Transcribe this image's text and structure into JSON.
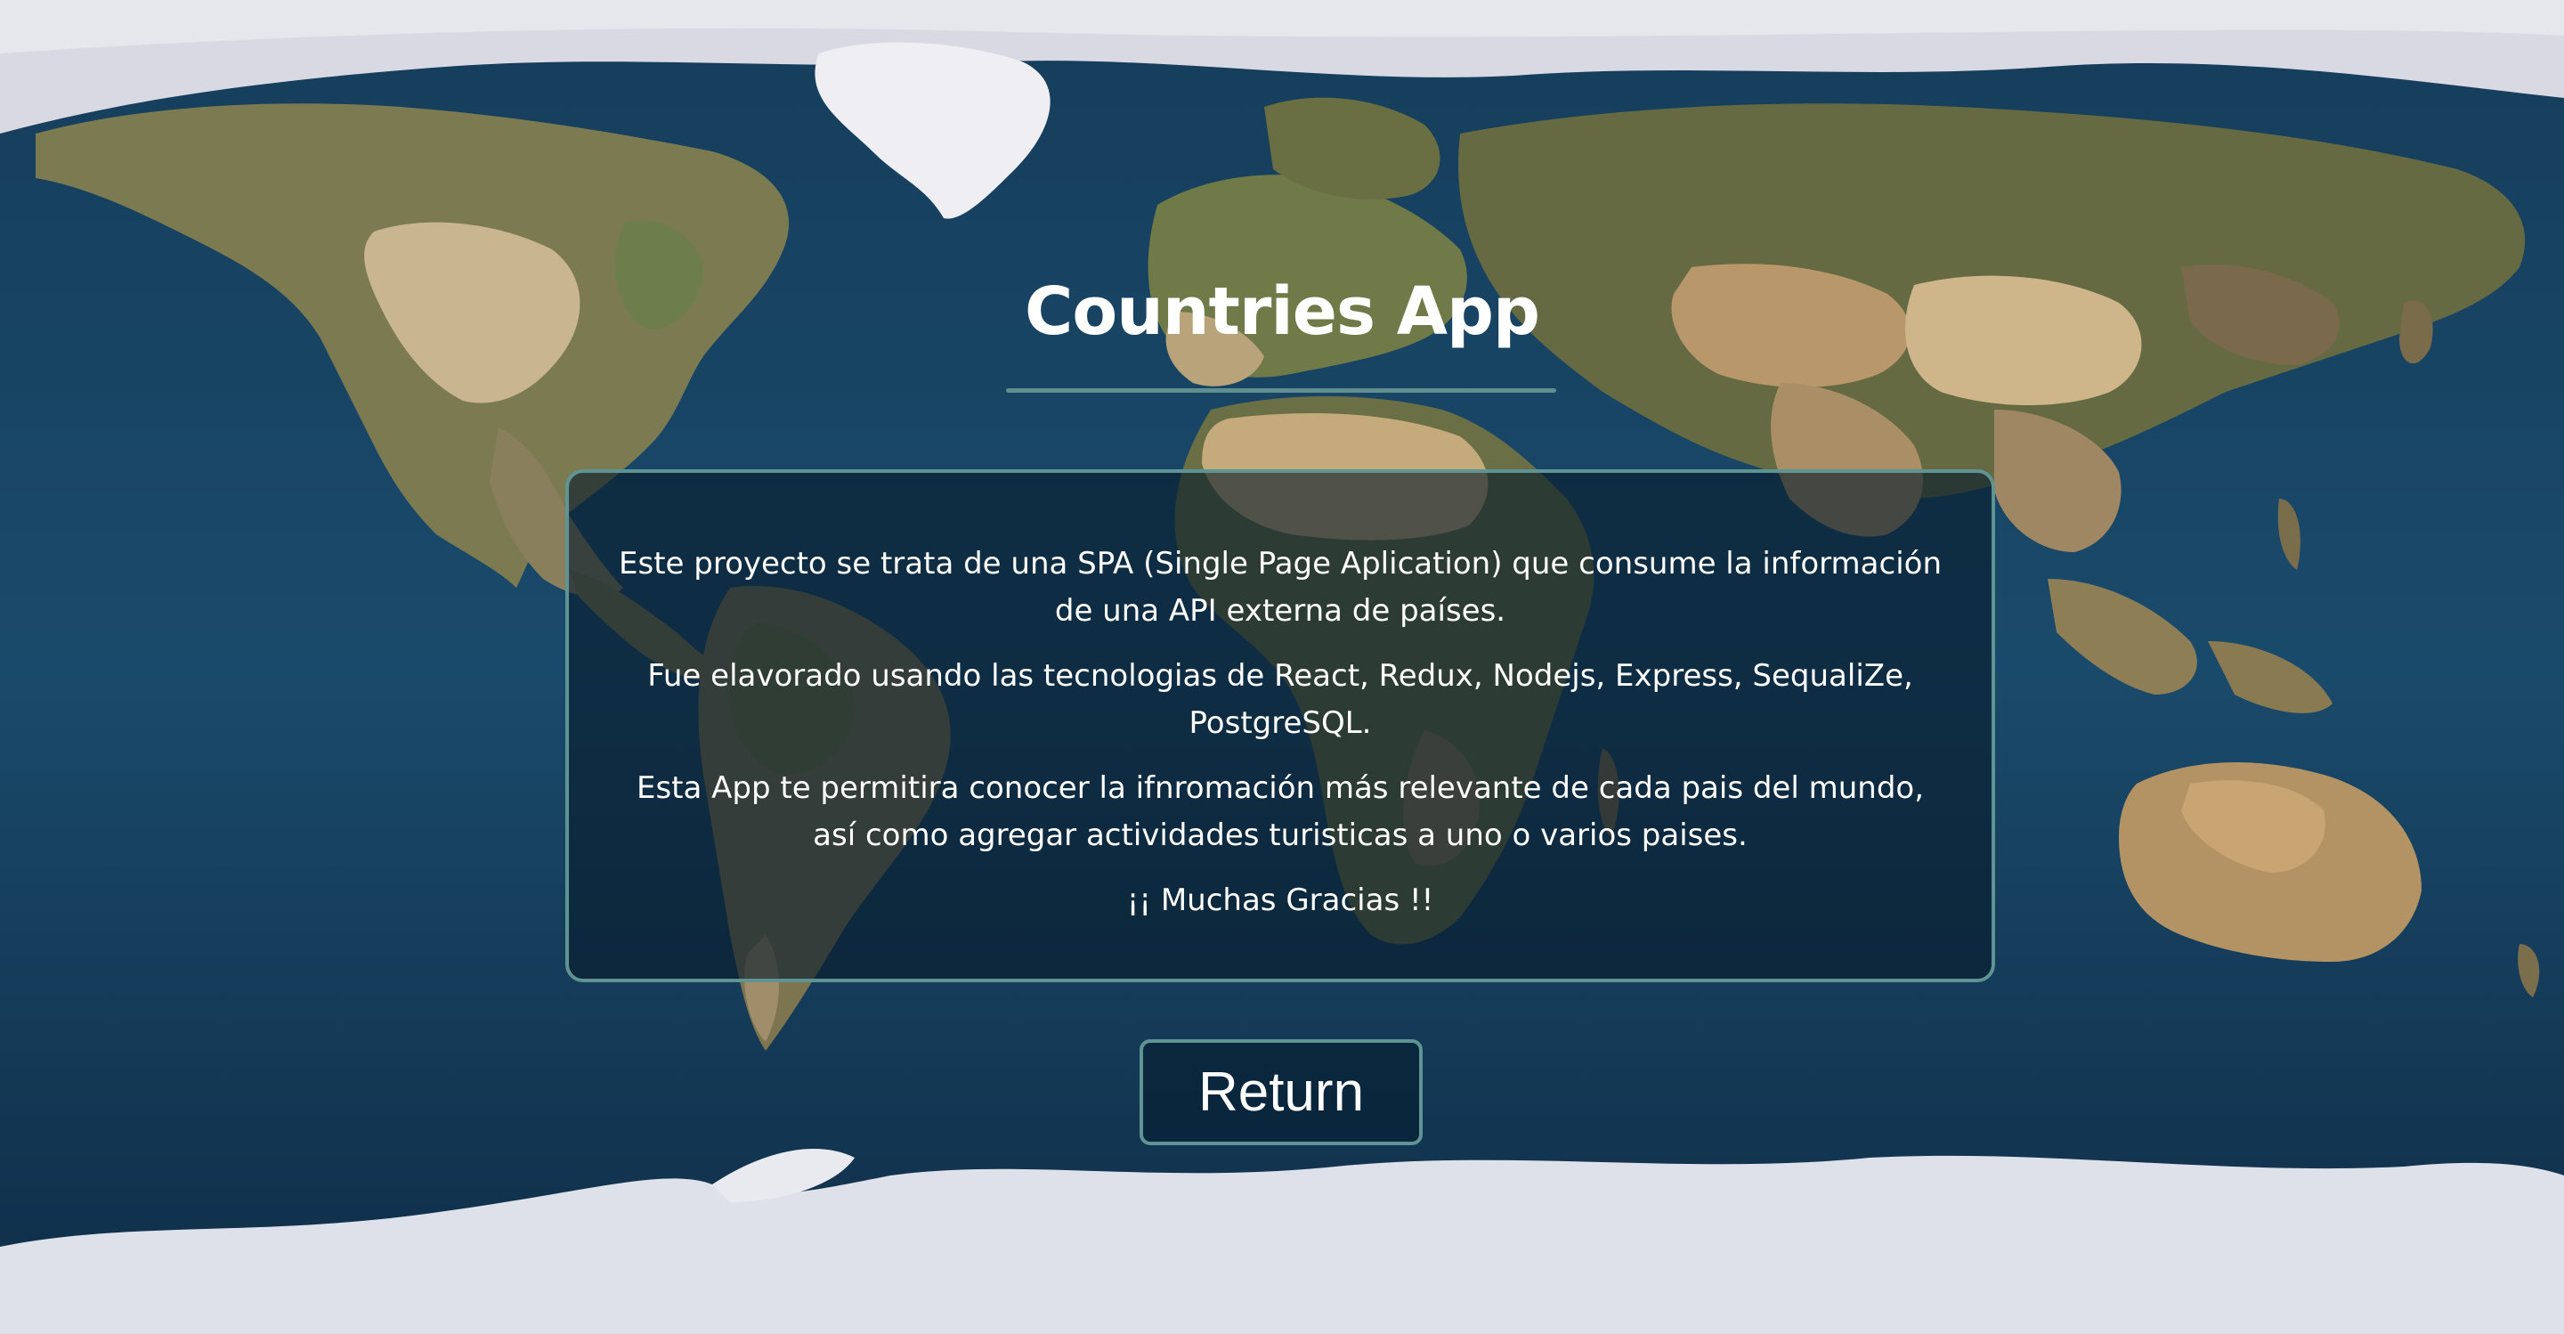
{
  "app": {
    "title": "Countries App"
  },
  "about": {
    "paragraphs": [
      "Este proyecto se trata de una SPA (Single Page Aplication) que consume la información de una API externa de países.",
      "Fue elavorado usando las tecnologias de React, Redux, Nodejs, Express, SequaliZe, PostgreSQL.",
      "Esta App te permitira conocer la ifnromación más relevante de cada pais del mundo, así como agregar actividades turisticas a uno o varios paises.",
      "¡¡ Muchas Gracias !!"
    ]
  },
  "actions": {
    "return_label": "Return"
  },
  "colors": {
    "ocean": "#143a57",
    "accent_border": "#5e9494",
    "text": "#ffffff",
    "ice": "#dfe1ea"
  }
}
